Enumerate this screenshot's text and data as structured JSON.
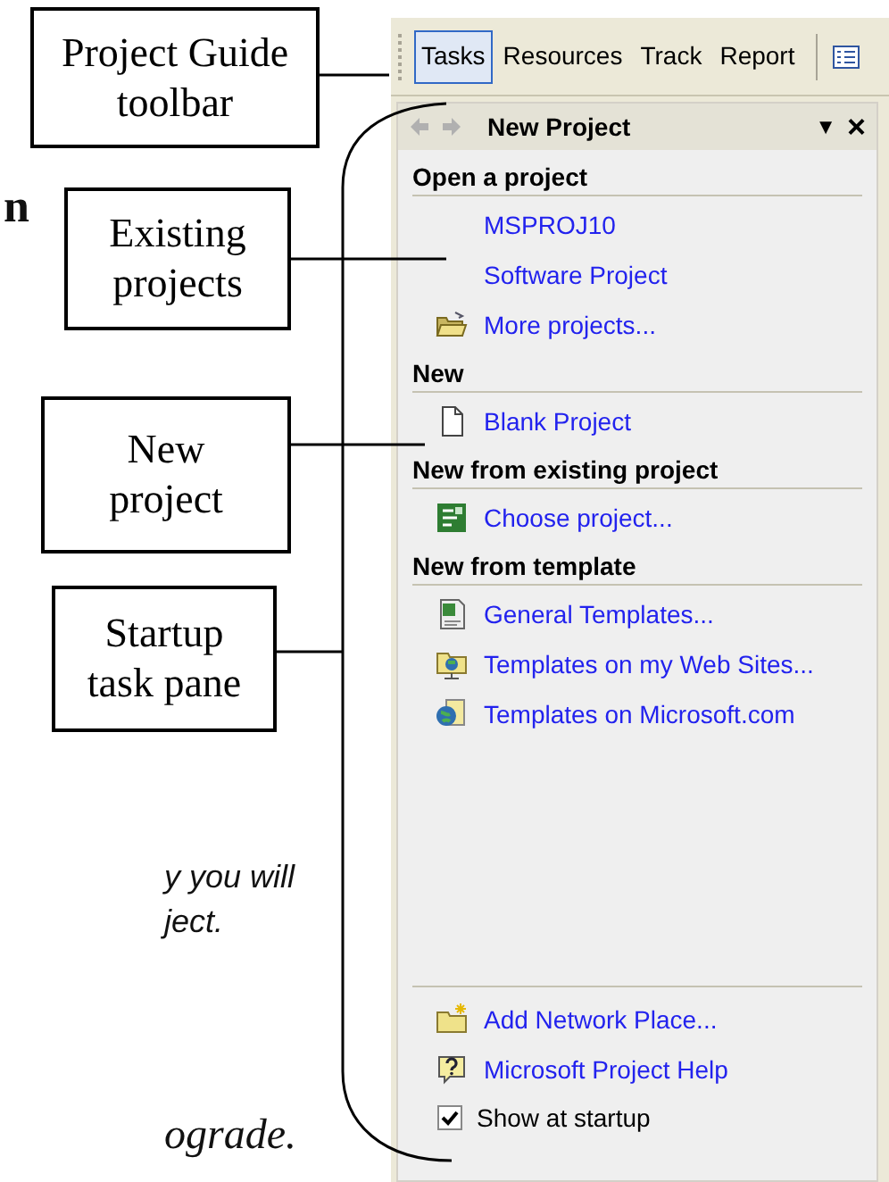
{
  "background_text": [
    {
      "kind": "bold-serif",
      "text": "n"
    },
    {
      "kind": "italic-sans",
      "text": "y you will"
    },
    {
      "kind": "italic-sans",
      "text": "ject."
    },
    {
      "kind": "italic-serif",
      "text": "ograde."
    }
  ],
  "annotations": [
    {
      "lines": [
        "Project Guide",
        "toolbar"
      ]
    },
    {
      "lines": [
        "Existing",
        "projects"
      ]
    },
    {
      "lines": [
        "New",
        "project"
      ]
    },
    {
      "lines": [
        "Startup",
        "task pane"
      ]
    }
  ],
  "toolbar": {
    "buttons": [
      {
        "label": "Tasks",
        "selected": true
      },
      {
        "label": "Resources",
        "selected": false
      },
      {
        "label": "Track",
        "selected": false
      },
      {
        "label": "Report",
        "selected": false
      }
    ]
  },
  "task_pane": {
    "title": "New Project",
    "dropdown_glyph": "▼",
    "close_glyph": "×",
    "sections": [
      {
        "heading": "Open a project",
        "items": [
          {
            "kind": "recent",
            "label": "MSPROJ10"
          },
          {
            "kind": "recent",
            "label": "Software Project"
          },
          {
            "kind": "folder",
            "label": "More projects..."
          }
        ]
      },
      {
        "heading": "New",
        "items": [
          {
            "kind": "blank",
            "label": "Blank Project"
          }
        ]
      },
      {
        "heading": "New from existing project",
        "items": [
          {
            "kind": "choose",
            "label": "Choose project..."
          }
        ]
      },
      {
        "heading": "New from template",
        "items": [
          {
            "kind": "template",
            "label": "General Templates..."
          },
          {
            "kind": "web",
            "label": "Templates on my Web Sites..."
          },
          {
            "kind": "globe",
            "label": "Templates on Microsoft.com"
          }
        ]
      }
    ],
    "footer_items": [
      {
        "kind": "network",
        "label": "Add Network Place..."
      },
      {
        "kind": "help",
        "label": "Microsoft Project Help"
      }
    ],
    "show_at_startup": {
      "label": "Show at startup",
      "checked": true
    }
  }
}
